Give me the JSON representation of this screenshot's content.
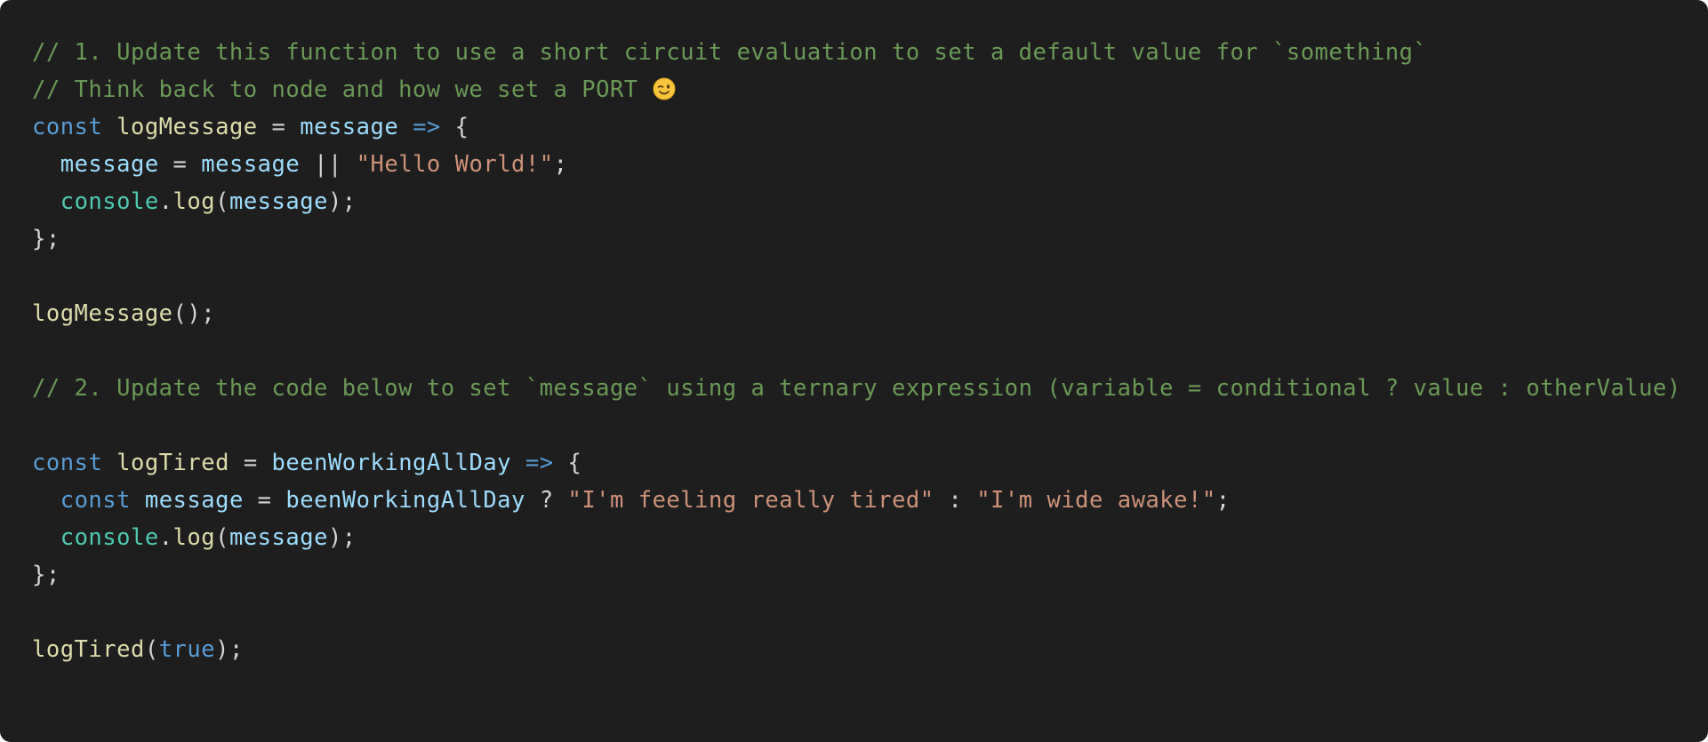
{
  "colors": {
    "background": "#1e1e1e",
    "comment": "#6a9955",
    "keyword": "#569cd6",
    "function": "#dcdcaa",
    "variable": "#9cdcfe",
    "string": "#ce9178",
    "object": "#4ec9b0",
    "plain": "#d4d4d4"
  },
  "icons": {
    "comment_emoji": "winking-face-icon"
  },
  "code": {
    "line1": {
      "comment": "// 1. Update this function to use a short circuit evaluation to set a default value for `something`"
    },
    "line2": {
      "comment": "// Think back to node and how we set a PORT"
    },
    "line3": {
      "kw": "const",
      "fn": "logMessage",
      "op": "=",
      "param": "message",
      "arrow": "=>",
      "brace": "{"
    },
    "line4": {
      "target": "message",
      "op": "=",
      "source": "message",
      "or": "||",
      "str": "\"Hello World!\"",
      "semi": ";"
    },
    "line5": {
      "obj": "console",
      "dot": ".",
      "method": "log",
      "open": "(",
      "arg": "message",
      "close": ");"
    },
    "line6": {
      "text": "};"
    },
    "line8": {
      "fn": "logMessage",
      "rest": "();"
    },
    "line10": {
      "comment": "// 2. Update the code below to set `message` using a ternary expression (variable = conditional ? value : otherValue)"
    },
    "line12": {
      "kw": "const",
      "fn": "logTired",
      "op": "=",
      "param": "beenWorkingAllDay",
      "arrow": "=>",
      "brace": "{"
    },
    "line13": {
      "kw": "const",
      "var": "message",
      "op": "=",
      "cond": "beenWorkingAllDay",
      "q": "?",
      "str1": "\"I'm feeling really tired\"",
      "colon": ":",
      "str2": "\"I'm wide awake!\"",
      "semi": ";"
    },
    "line14": {
      "obj": "console",
      "dot": ".",
      "method": "log",
      "open": "(",
      "arg": "message",
      "close": ");"
    },
    "line15": {
      "text": "};"
    },
    "line17": {
      "fn": "logTired",
      "open": "(",
      "arg": "true",
      "close": ");"
    }
  }
}
